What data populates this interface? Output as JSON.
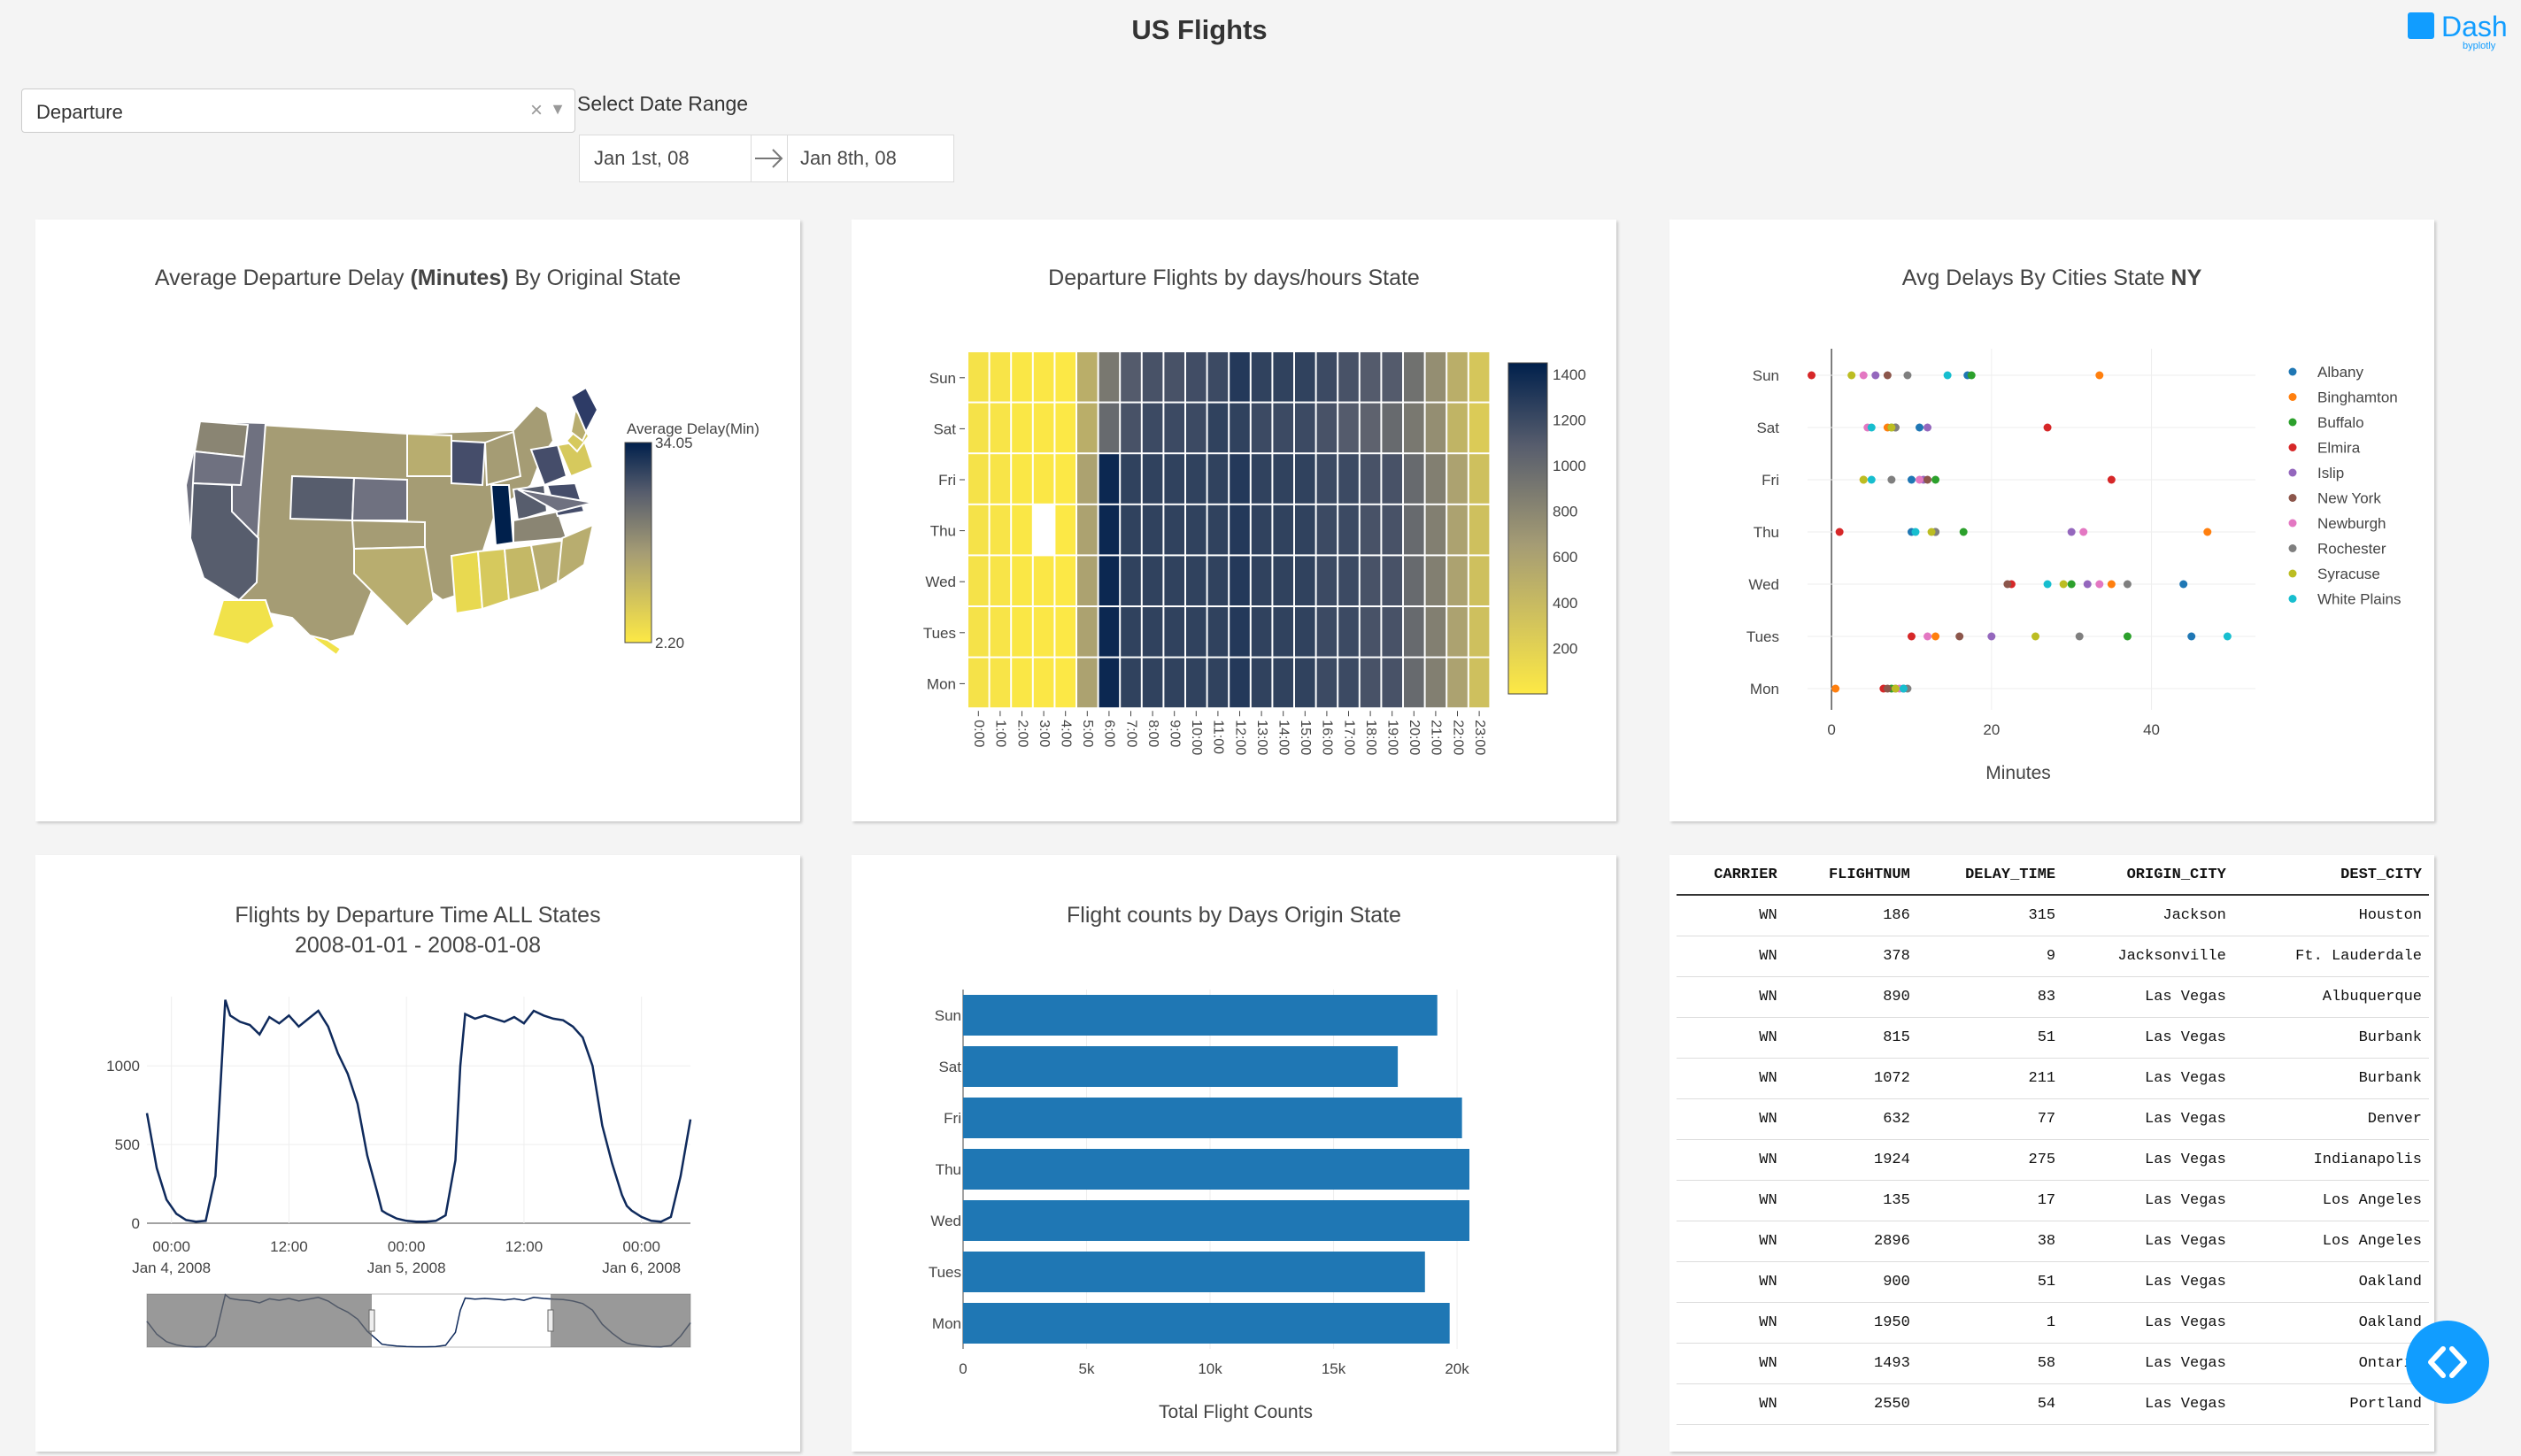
{
  "header": {
    "title": "US Flights",
    "logo_text": "Dash",
    "logo_by": "byplotly"
  },
  "controls": {
    "dropdown_value": "Departure",
    "date_label": "Select Date Range",
    "date_start": "Jan 1st, 08",
    "date_end": "Jan 8th, 08"
  },
  "colors": {
    "accent": "#119dff",
    "navy": "#00204c",
    "yellow": "#fde945",
    "bar": "#1f77b4"
  },
  "map_chart": {
    "title_pre": "Average Departure Delay ",
    "title_bold": "(Minutes)",
    "title_post": " By Original State",
    "colorbar_title": "Average Delay(Min)",
    "colorbar_max": "34.05",
    "colorbar_min": "2.20"
  },
  "chart_data": [
    {
      "type": "heatmap",
      "title": "Departure Flights by days/hours State",
      "y_categories": [
        "Sun",
        "Sat",
        "Fri",
        "Thu",
        "Wed",
        "Tues",
        "Mon"
      ],
      "x_categories": [
        "0:00",
        "1:00",
        "2:00",
        "3:00",
        "4:00",
        "5:00",
        "6:00",
        "7:00",
        "8:00",
        "9:00",
        "10:00",
        "11:00",
        "12:00",
        "13:00",
        "14:00",
        "15:00",
        "16:00",
        "17:00",
        "18:00",
        "19:00",
        "20:00",
        "21:00",
        "22:00",
        "23:00"
      ],
      "colorbar_ticks": [
        "1400",
        "1200",
        "1000",
        "800",
        "600",
        "400",
        "200"
      ],
      "zlim": [
        0,
        1450
      ],
      "z": [
        [
          60,
          40,
          20,
          15,
          10,
          500,
          900,
          1100,
          1150,
          1150,
          1180,
          1200,
          1300,
          1250,
          1250,
          1250,
          1200,
          1150,
          1100,
          1100,
          950,
          750,
          500,
          300
        ],
        [
          60,
          40,
          20,
          15,
          10,
          500,
          1000,
          1150,
          1200,
          1200,
          1200,
          1250,
          1250,
          1200,
          1200,
          1200,
          1150,
          1100,
          1050,
          1000,
          900,
          750,
          450,
          250
        ],
        [
          60,
          40,
          20,
          15,
          10,
          600,
          1400,
          1250,
          1250,
          1250,
          1250,
          1250,
          1300,
          1250,
          1250,
          1250,
          1200,
          1200,
          1150,
          1150,
          1000,
          850,
          600,
          350
        ],
        [
          60,
          40,
          20,
          null,
          10,
          600,
          1400,
          1250,
          1250,
          1250,
          1250,
          1250,
          1300,
          1250,
          1250,
          1250,
          1200,
          1200,
          1150,
          1150,
          1000,
          850,
          600,
          350
        ],
        [
          60,
          40,
          20,
          15,
          10,
          600,
          1400,
          1250,
          1250,
          1250,
          1250,
          1250,
          1300,
          1250,
          1250,
          1250,
          1200,
          1200,
          1150,
          1150,
          1000,
          850,
          600,
          350
        ],
        [
          60,
          40,
          20,
          15,
          10,
          600,
          1400,
          1250,
          1250,
          1250,
          1250,
          1250,
          1300,
          1250,
          1250,
          1250,
          1200,
          1200,
          1150,
          1150,
          1000,
          850,
          600,
          350
        ],
        [
          60,
          40,
          20,
          15,
          10,
          600,
          1400,
          1250,
          1250,
          1250,
          1250,
          1250,
          1300,
          1250,
          1250,
          1250,
          1200,
          1200,
          1150,
          1150,
          1000,
          850,
          600,
          350
        ]
      ]
    },
    {
      "type": "scatter",
      "title_pre": "Avg Delays By Cities State ",
      "title_bold": "NY",
      "xlabel": "Minutes",
      "xlim": [
        -3,
        53
      ],
      "x_ticks": [
        0,
        20,
        40
      ],
      "y_categories": [
        "Sun",
        "Sat",
        "Fri",
        "Thu",
        "Wed",
        "Tues",
        "Mon"
      ],
      "legend_position": "right",
      "series": [
        {
          "name": "Albany",
          "color": "#1f77b4",
          "points": [
            [
              17,
              "Sun"
            ],
            [
              11,
              "Sat"
            ],
            [
              10,
              "Fri"
            ],
            [
              10,
              "Thu"
            ],
            [
              44,
              "Wed"
            ],
            [
              45,
              "Tues"
            ],
            [
              9,
              "Mon"
            ]
          ]
        },
        {
          "name": "Binghamton",
          "color": "#ff7f0e",
          "points": [
            [
              33.5,
              "Sun"
            ],
            [
              7,
              "Sat"
            ],
            [
              4,
              "Fri"
            ],
            [
              47,
              "Thu"
            ],
            [
              35,
              "Wed"
            ],
            [
              13,
              "Tues"
            ],
            [
              0.5,
              "Mon"
            ]
          ]
        },
        {
          "name": "Buffalo",
          "color": "#2ca02c",
          "points": [
            [
              17.5,
              "Sun"
            ],
            [
              7.5,
              "Sat"
            ],
            [
              13,
              "Fri"
            ],
            [
              16.5,
              "Thu"
            ],
            [
              30,
              "Wed"
            ],
            [
              37,
              "Tues"
            ],
            [
              7.5,
              "Mon"
            ]
          ]
        },
        {
          "name": "Elmira",
          "color": "#d62728",
          "points": [
            [
              -2.5,
              "Sun"
            ],
            [
              27,
              "Sat"
            ],
            [
              35,
              "Fri"
            ],
            [
              1,
              "Thu"
            ],
            [
              22.5,
              "Wed"
            ],
            [
              10,
              "Tues"
            ],
            [
              6.5,
              "Mon"
            ]
          ]
        },
        {
          "name": "Islip",
          "color": "#9467bd",
          "points": [
            [
              5.5,
              "Sun"
            ],
            [
              12,
              "Sat"
            ],
            [
              11.5,
              "Fri"
            ],
            [
              30,
              "Thu"
            ],
            [
              32,
              "Wed"
            ],
            [
              20,
              "Tues"
            ],
            [
              8,
              "Mon"
            ]
          ]
        },
        {
          "name": "New York",
          "color": "#8c564b",
          "points": [
            [
              7,
              "Sun"
            ],
            [
              8,
              "Sat"
            ],
            [
              12,
              "Fri"
            ],
            [
              13,
              "Thu"
            ],
            [
              22,
              "Wed"
            ],
            [
              16,
              "Tues"
            ],
            [
              7,
              "Mon"
            ]
          ]
        },
        {
          "name": "Newburgh",
          "color": "#e377c2",
          "points": [
            [
              4,
              "Sun"
            ],
            [
              4.5,
              "Sat"
            ],
            [
              11,
              "Fri"
            ],
            [
              31.5,
              "Thu"
            ],
            [
              33.5,
              "Wed"
            ],
            [
              12,
              "Tues"
            ],
            [
              8.5,
              "Mon"
            ]
          ]
        },
        {
          "name": "Rochester",
          "color": "#7f7f7f",
          "points": [
            [
              9.5,
              "Sun"
            ],
            [
              8,
              "Sat"
            ],
            [
              7.5,
              "Fri"
            ],
            [
              13,
              "Thu"
            ],
            [
              37,
              "Wed"
            ],
            [
              31,
              "Tues"
            ],
            [
              9.5,
              "Mon"
            ]
          ]
        },
        {
          "name": "Syracuse",
          "color": "#bcbd22",
          "points": [
            [
              2.5,
              "Sun"
            ],
            [
              7.5,
              "Sat"
            ],
            [
              4,
              "Fri"
            ],
            [
              12.5,
              "Thu"
            ],
            [
              29,
              "Wed"
            ],
            [
              25.5,
              "Tues"
            ],
            [
              8,
              "Mon"
            ]
          ]
        },
        {
          "name": "White Plains",
          "color": "#17becf",
          "points": [
            [
              14.5,
              "Sun"
            ],
            [
              5,
              "Sat"
            ],
            [
              5,
              "Fri"
            ],
            [
              10.5,
              "Thu"
            ],
            [
              27,
              "Wed"
            ],
            [
              49.5,
              "Tues"
            ],
            [
              9,
              "Mon"
            ]
          ]
        }
      ]
    },
    {
      "type": "line",
      "title": "Flights by Departure Time ALL States",
      "subtitle": "2008-01-01 - 2008-01-08",
      "y_ticks": [
        0,
        500,
        1000
      ],
      "ylim": [
        0,
        1440
      ],
      "x_ticks": [
        {
          "hour": 0,
          "top": "00:00",
          "bottom": "Jan 4, 2008"
        },
        {
          "hour": 12,
          "top": "12:00",
          "bottom": ""
        },
        {
          "hour": 24,
          "top": "00:00",
          "bottom": "Jan 5, 2008"
        },
        {
          "hour": 36,
          "top": "12:00",
          "bottom": ""
        },
        {
          "hour": 48,
          "top": "00:00",
          "bottom": "Jan 6, 2008"
        }
      ],
      "xlim": [
        -2.5,
        53
      ],
      "x": [
        -2.5,
        -1.5,
        -0.5,
        0.5,
        1.5,
        2.5,
        3.5,
        4.5,
        5.5,
        6,
        7,
        8,
        9,
        10,
        11,
        12,
        13,
        14,
        15,
        16,
        17,
        18,
        19,
        20,
        21,
        21.5,
        22,
        23,
        24,
        25,
        26,
        27,
        28,
        29,
        29.5,
        30,
        31,
        32,
        33,
        34,
        35,
        36,
        37,
        38,
        39,
        40,
        41,
        42,
        43,
        44,
        45,
        46,
        46.5,
        47,
        48,
        49,
        50,
        51,
        52,
        53
      ],
      "y": [
        700,
        350,
        150,
        60,
        20,
        10,
        15,
        300,
        1420,
        1320,
        1280,
        1260,
        1200,
        1310,
        1270,
        1320,
        1250,
        1300,
        1350,
        1250,
        1080,
        950,
        760,
        430,
        200,
        80,
        60,
        30,
        15,
        10,
        10,
        15,
        50,
        400,
        1000,
        1330,
        1300,
        1320,
        1300,
        1280,
        1310,
        1270,
        1350,
        1320,
        1300,
        1290,
        1250,
        1180,
        1000,
        620,
        380,
        180,
        110,
        80,
        40,
        15,
        10,
        40,
        300,
        660
      ]
    },
    {
      "type": "bar",
      "orientation": "h",
      "title": "Flight counts by Days Origin State",
      "xlabel": "Total Flight Counts",
      "categories": [
        "Sun",
        "Sat",
        "Fri",
        "Thu",
        "Wed",
        "Tues",
        "Mon"
      ],
      "values": [
        19200,
        17600,
        20200,
        20500,
        20500,
        18700,
        19700
      ],
      "xlim": [
        0,
        20500
      ],
      "x_ticks": [
        "0",
        "5k",
        "10k",
        "15k",
        "20k"
      ]
    }
  ],
  "table": {
    "columns": [
      "CARRIER",
      "FLIGHTNUM",
      "DELAY_TIME",
      "ORIGIN_CITY",
      "DEST_CITY"
    ],
    "rows": [
      [
        "WN",
        "186",
        "315",
        "Jackson",
        "Houston"
      ],
      [
        "WN",
        "378",
        "9",
        "Jacksonville",
        "Ft. Lauderdale"
      ],
      [
        "WN",
        "890",
        "83",
        "Las Vegas",
        "Albuquerque"
      ],
      [
        "WN",
        "815",
        "51",
        "Las Vegas",
        "Burbank"
      ],
      [
        "WN",
        "1072",
        "211",
        "Las Vegas",
        "Burbank"
      ],
      [
        "WN",
        "632",
        "77",
        "Las Vegas",
        "Denver"
      ],
      [
        "WN",
        "1924",
        "275",
        "Las Vegas",
        "Indianapolis"
      ],
      [
        "WN",
        "135",
        "17",
        "Las Vegas",
        "Los Angeles"
      ],
      [
        "WN",
        "2896",
        "38",
        "Las Vegas",
        "Los Angeles"
      ],
      [
        "WN",
        "900",
        "51",
        "Las Vegas",
        "Oakland"
      ],
      [
        "WN",
        "1950",
        "1",
        "Las Vegas",
        "Oakland"
      ],
      [
        "WN",
        "1493",
        "58",
        "Las Vegas",
        "Ontario"
      ],
      [
        "WN",
        "2550",
        "54",
        "Las Vegas",
        "Portland"
      ]
    ]
  }
}
